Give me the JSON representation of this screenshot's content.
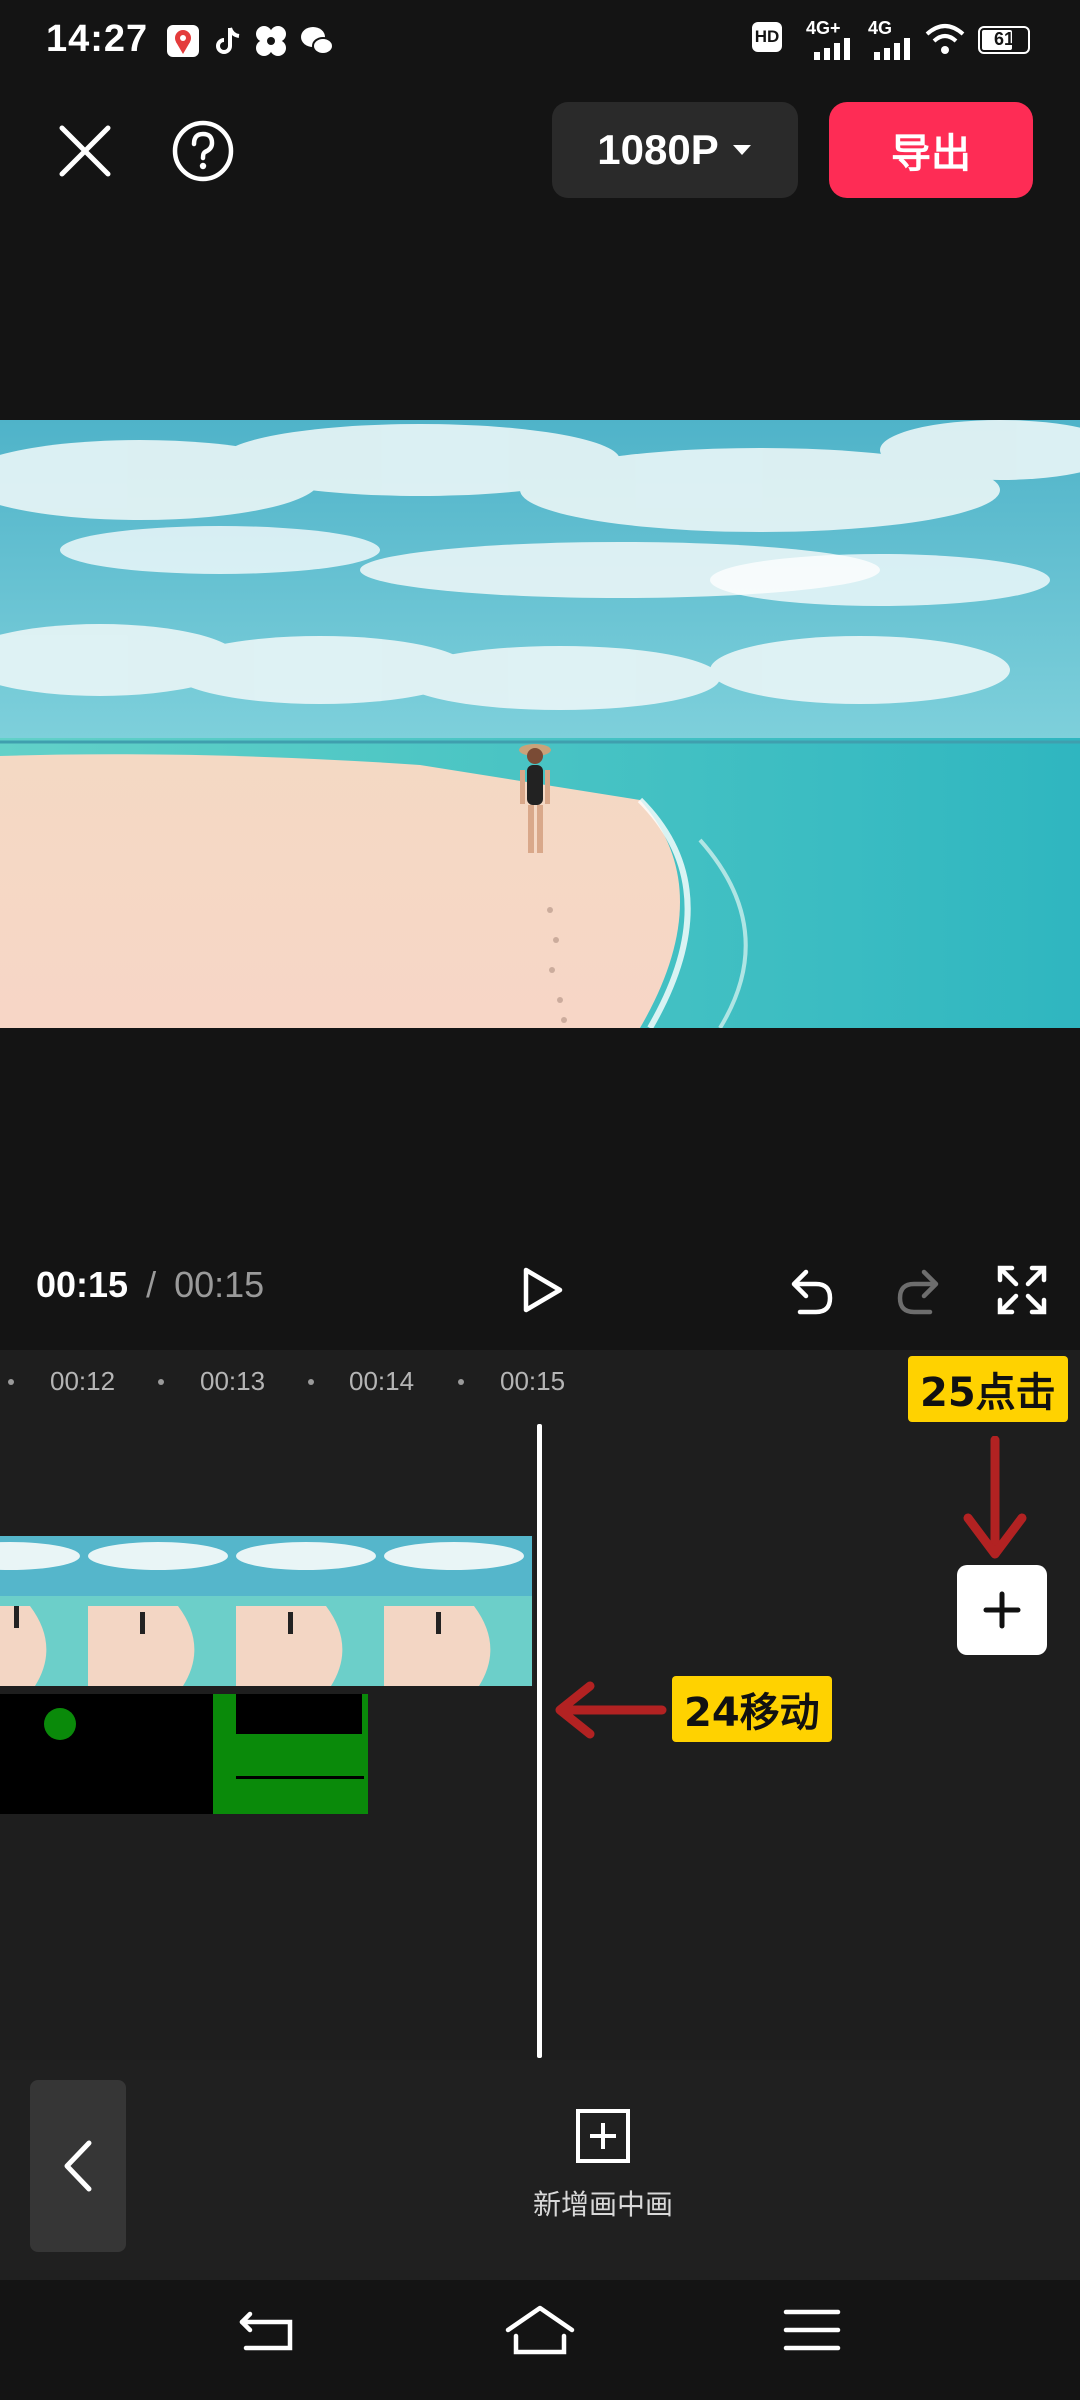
{
  "status_bar": {
    "time": "14:27",
    "network_labels": [
      "HD",
      "4G+",
      "4G"
    ],
    "battery_level": "61",
    "notification_icons": [
      "map-pin-icon",
      "tiktok-icon",
      "fan-icon",
      "wechat-icon"
    ]
  },
  "toolbar": {
    "resolution_label": "1080P",
    "export_label": "导出"
  },
  "playback": {
    "current_time": "00:15",
    "separator": "/",
    "total_time": "00:15"
  },
  "timeline": {
    "ruler_labels": [
      "00:12",
      "00:13",
      "00:14",
      "00:15"
    ]
  },
  "annotations": {
    "step25": "25点击",
    "step24": "24移动"
  },
  "bottom_bar": {
    "add_pip_label": "新增画中画"
  },
  "colors": {
    "accent": "#fe2c55",
    "callout": "#ffd200",
    "arrow": "#b22222",
    "overlay_green": "#0a8a0a"
  }
}
